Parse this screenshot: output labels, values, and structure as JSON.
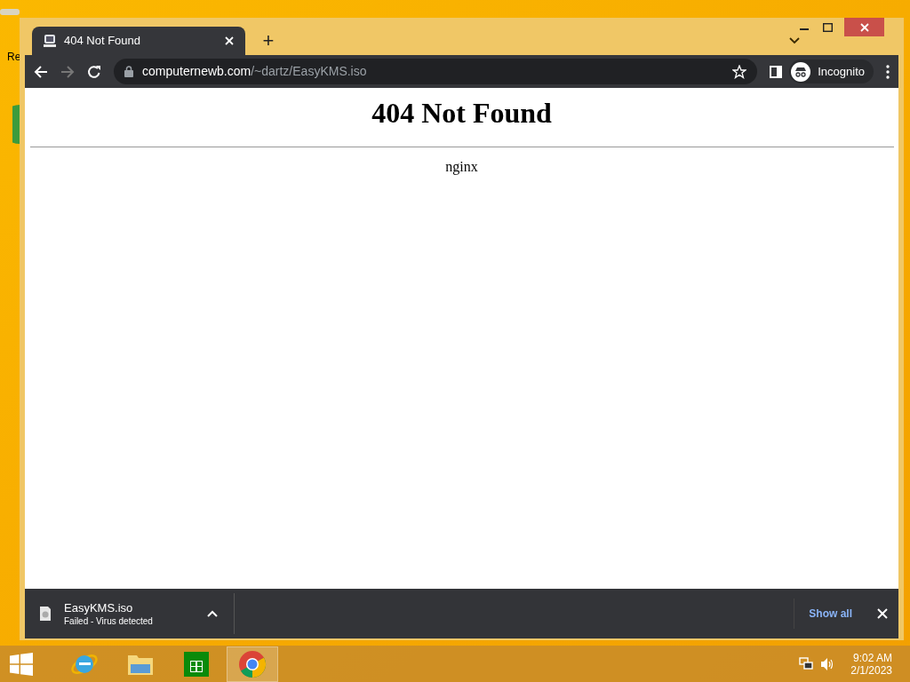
{
  "desktop": {
    "icons": [
      {
        "label": "Re"
      }
    ]
  },
  "window": {
    "tabs": [
      {
        "title": "404 Not Found",
        "selected": true
      }
    ],
    "new_tab": "+"
  },
  "toolbar": {
    "url_host": "computernewb.com",
    "url_path": "/~dartz/EasyKMS.iso",
    "profile": "Incognito"
  },
  "page": {
    "heading": "404 Not Found",
    "footer": "nginx"
  },
  "download_bar": {
    "items": [
      {
        "file": "EasyKMS.iso",
        "status": "Failed - Virus detected"
      }
    ],
    "show_all": "Show all"
  },
  "taskbar": {
    "apps": [
      {
        "kind": "ie",
        "selected": false
      },
      {
        "kind": "explorer",
        "selected": false
      },
      {
        "kind": "store",
        "selected": false
      },
      {
        "kind": "chrome",
        "selected": true
      }
    ],
    "time": "9:02 AM",
    "date": "2/1/2023"
  }
}
